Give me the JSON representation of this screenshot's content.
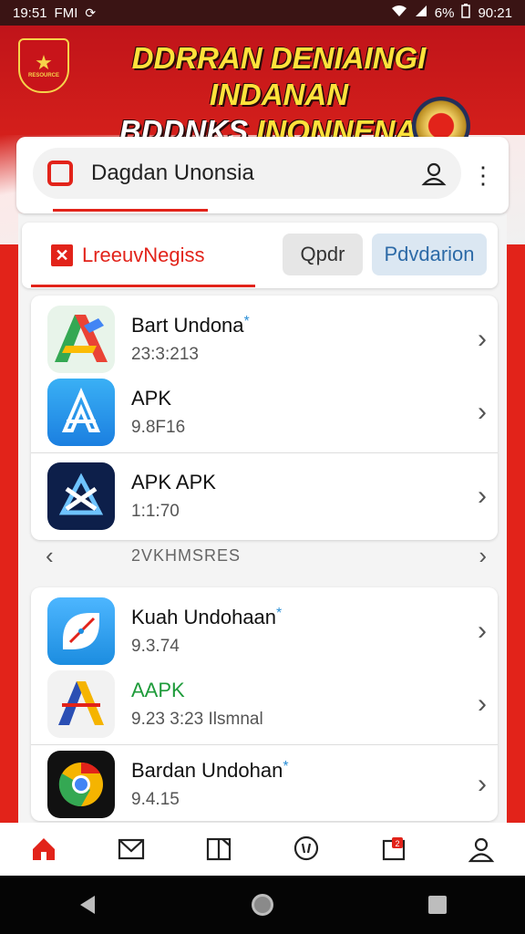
{
  "status_bar": {
    "time_left": "19:51",
    "carrier": "FMI",
    "battery": "6%",
    "time_right": "90:21"
  },
  "banner": {
    "emblem_text": "RESOURCE",
    "line1": "DDRRAN DENIAINGI INDANAN",
    "line2_a": "BDDNKS ",
    "line2_b": "INONNENAN"
  },
  "search": {
    "text": "Dagdan Unonsia"
  },
  "tabs": {
    "active": "LreeuvNegiss",
    "chip1": "Qpdr",
    "chip2": "Pdvdarion"
  },
  "list1": [
    {
      "title": "Bart Undona",
      "starred": "*",
      "sub": "23:3:213",
      "icon": "android-studio-icon"
    },
    {
      "title": "APK",
      "starred": "",
      "sub": "9.8F16",
      "icon": "app-store-icon"
    },
    {
      "title": "APK APK",
      "starred": "",
      "sub": "1:1:70",
      "icon": "apk-x-icon"
    }
  ],
  "pager": {
    "text": "2VKHMSRES"
  },
  "list2": [
    {
      "title": "Kuah Undohaan",
      "starred": "*",
      "sub": "9.3.74",
      "icon": "compass-icon"
    },
    {
      "title": "AAPK",
      "starred": "",
      "sub": "9.23 3:23 Ilsmnal",
      "icon": "vector-icon"
    },
    {
      "title": "Bardan Undohan",
      "starred": "*",
      "sub": "9.4.15",
      "icon": "chrome-icon"
    }
  ],
  "colors": {
    "accent": "#e2231a",
    "title_green": "#1e9b3a"
  }
}
